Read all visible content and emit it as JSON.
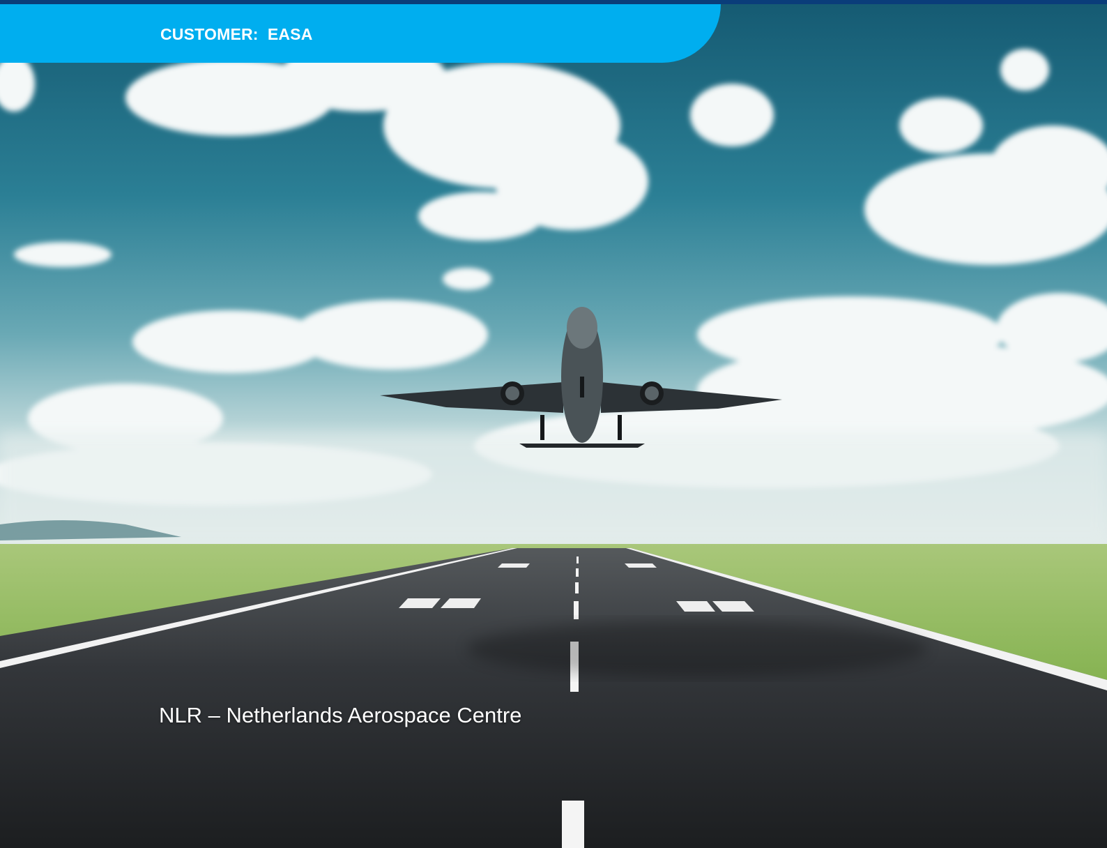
{
  "banner": {
    "text": "CUSTOMER:  EASA",
    "color": "#00aeef",
    "top_rule_color": "#0a3d7a"
  },
  "organization": {
    "text": "NLR – Netherlands Aerospace Centre"
  },
  "background": {
    "icon": "airplane-takeoff-runway-photo",
    "sky_color": "#1f6f86",
    "grass_color": "#6fae2c",
    "runway_color": "#2a2c2e"
  }
}
